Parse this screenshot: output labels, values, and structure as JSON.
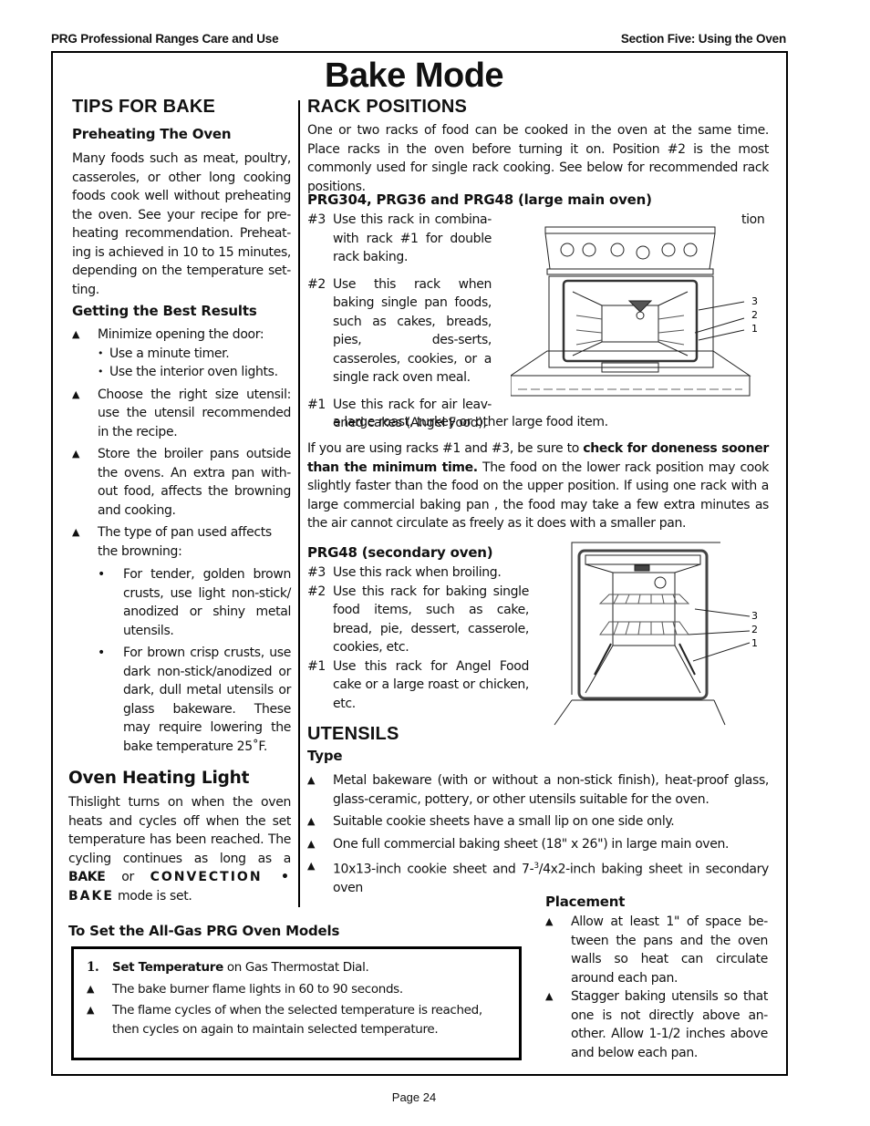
{
  "running_header": {
    "left": "PRG Professional Ranges Care and Use",
    "right": "Section Five: Using the Oven"
  },
  "page_title": "Bake Mode",
  "tips_for_bake": {
    "heading": "TIPS FOR BAKE",
    "preheating": {
      "heading": "Preheating The Oven",
      "text": "Many foods such as meat, poultry, casseroles, or other long cooking foods cook well without preheating the oven. See your recipe for pre-heating recommendation. Preheat-ing is achieved in 10 to 15  minutes, depending on the temperature set-ting."
    },
    "best_results": {
      "heading": "Getting the Best Results",
      "items": [
        {
          "text": "Minimize opening the door:",
          "sub": [
            "Use a minute timer.",
            "Use the interior oven lights."
          ]
        },
        {
          "text": "Choose the right size utensil: use the utensil recommended in the recipe."
        },
        {
          "text": "Store the broiler pans outside the ovens. An extra pan with-out food, affects the browning and cooking."
        },
        {
          "text": "The type of pan used affects the browning:"
        }
      ],
      "pan_types": [
        "For tender, golden brown crusts, use light non-stick/ anodized or shiny metal utensils.",
        "For brown crisp crusts, use dark non-stick/anodized or dark, dull metal utensils  or glass bakeware. These may require lowering the  bake temperature 25˚F."
      ]
    }
  },
  "oven_heating_light": {
    "heading": "Oven Heating Light",
    "text_before": "Thislight turns on when the oven heats and cycles off when the set temperature has been reached. The cycling continues as long as a ",
    "bold_1": "BAKE",
    "text_mid": " or ",
    "bold_2": "CONVECTION • BAKE",
    "text_after": " mode is set."
  },
  "rack_positions": {
    "heading": "RACK POSITIONS",
    "intro": "One or two racks of food can be cooked in the oven at the same time. Place racks in the oven before turning it on. Position #2 is the most commonly used for single rack cooking. See below for recommended rack positions.",
    "main_oven": {
      "heading": "PRG304, PRG36 and PRG48 (large main oven)",
      "items": [
        {
          "marker": "#3",
          "text": "Use this rack in combina- with rack #1 for double rack baking.",
          "stray": "tion"
        },
        {
          "marker": "#2",
          "text": "Use this rack when baking single pan foods, such as cakes, breads, pies, des-serts, casseroles, cookies, or a single rack oven meal."
        },
        {
          "marker": "#1",
          "text": "Use this rack for air leav-ened cakes (Angel Food),",
          "continuation": "a large roast, turkey or other large food item."
        }
      ],
      "diagram_labels": [
        "3",
        "2",
        "1"
      ]
    },
    "note": {
      "before": "If you are using racks #1 and #3, be sure to ",
      "bold": "check for doneness sooner than the minimum time.",
      "after": " The food on the lower rack position may cook slightly faster than the food on the upper position. If using one rack with a large commercial baking pan , the food may take a few extra minutes as the air cannot circulate as freely as it does with a smaller pan."
    },
    "secondary_oven": {
      "heading": "PRG48 (secondary oven)",
      "items": [
        {
          "marker": "#3",
          "text": "Use this rack when broiling."
        },
        {
          "marker": "#2",
          "text": "Use this rack for baking single food items, such as cake, bread, pie, dessert, casserole, cookies, etc."
        },
        {
          "marker": "#1",
          "text": "Use this rack for Angel Food cake or a large roast or chicken, etc."
        }
      ],
      "diagram_labels": [
        "3",
        "2",
        "1"
      ]
    }
  },
  "utensils": {
    "heading": "UTENSILS",
    "type": {
      "heading": "Type",
      "items": [
        "Metal bakeware (with or without a non-stick finish),  heat-proof glass, glass-ceramic, pottery, or other utensils suitable for the oven.",
        "Suitable cookie sheets have a small lip on one side only.",
        "One full commercial baking sheet (18\" x 26\") in large main oven."
      ],
      "last_item": {
        "before": "10x13-inch cookie sheet and 7-",
        "sup": "3",
        "after": "/4x2-inch baking sheet in secondary oven"
      }
    },
    "placement": {
      "heading": "Placement",
      "items": [
        "Allow at least 1\" of space be-tween the pans and the oven walls so heat can circulate around each pan.",
        "Stagger baking utensils so that one is not directly above an-other. Allow 1-1/2 inches above and below each pan."
      ]
    }
  },
  "gas_models": {
    "heading": "To Set the All-Gas PRG Oven Models",
    "step": {
      "number": "1.",
      "bold": "Set Temperature",
      "text": " on Gas Thermostat Dial."
    },
    "items": [
      "The bake burner flame lights in 60 to 90 seconds.",
      "The flame cycles of when the selected temperature is reached, then cycles on again to maintain selected temperature."
    ]
  },
  "markers": {
    "triangle": "▲",
    "bullet": "•"
  },
  "page_number": "Page 24"
}
